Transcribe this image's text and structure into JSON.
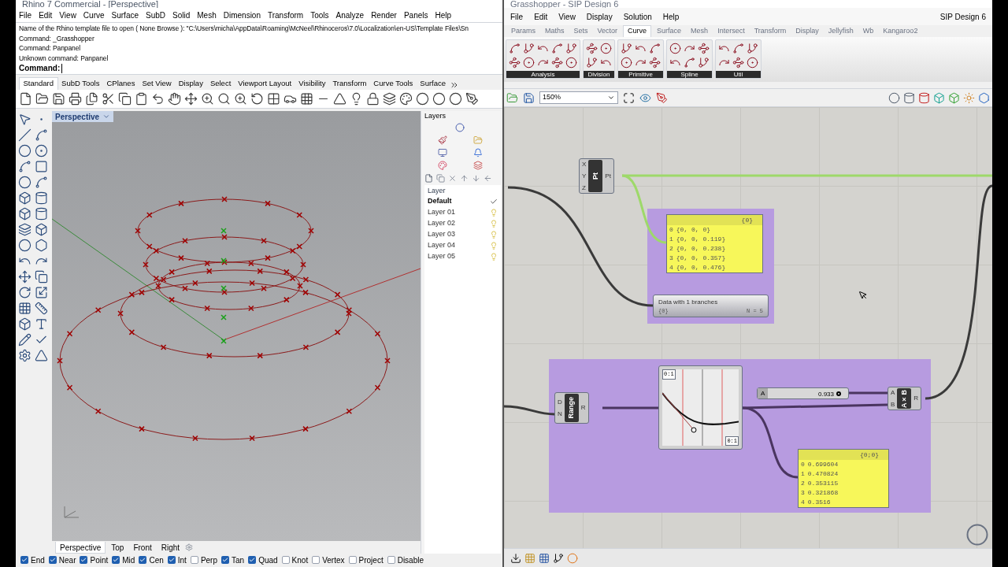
{
  "rhino": {
    "title": "Rhino 7 Commercial - [Perspective]",
    "menu": [
      "File",
      "Edit",
      "View",
      "Curve",
      "Surface",
      "SubD",
      "Solid",
      "Mesh",
      "Dimension",
      "Transform",
      "Tools",
      "Analyze",
      "Render",
      "Panels",
      "Help"
    ],
    "command_history": [
      "Name of the Rhino template file to open ( None  Browse ): \"C:\\Users\\micha\\AppData\\Roaming\\McNeel\\Rhinoceros\\7.0\\Localization\\en-US\\Template Files\\Sn",
      "Command: _Grasshopper",
      "Command: Panpanel",
      "Unknown command: Panpanel"
    ],
    "command_prompt": "Command:",
    "toolbar_tabs": [
      {
        "label": "Standard",
        "selected": true
      },
      {
        "label": "SubD Tools",
        "selected": false
      },
      {
        "label": "CPlanes",
        "selected": false
      },
      {
        "label": "Set View",
        "selected": false
      },
      {
        "label": "Display",
        "selected": false
      },
      {
        "label": "Select",
        "selected": false
      },
      {
        "label": "Viewport Layout",
        "selected": false
      },
      {
        "label": "Visibility",
        "selected": false
      },
      {
        "label": "Transform",
        "selected": false
      },
      {
        "label": "Curve Tools",
        "selected": false
      },
      {
        "label": "Surface",
        "selected": false
      }
    ],
    "viewport_title": "Perspective",
    "layers": {
      "title": "Layers",
      "column": "Layer",
      "items": [
        {
          "name": "Default",
          "current": true
        },
        {
          "name": "Layer 01",
          "current": false
        },
        {
          "name": "Layer 02",
          "current": false
        },
        {
          "name": "Layer 03",
          "current": false
        },
        {
          "name": "Layer 04",
          "current": false
        },
        {
          "name": "Layer 05",
          "current": false
        }
      ]
    },
    "viewport_tabs": [
      {
        "label": "Perspective",
        "selected": true
      },
      {
        "label": "Top",
        "selected": false
      },
      {
        "label": "Front",
        "selected": false
      },
      {
        "label": "Right",
        "selected": false
      }
    ],
    "osnaps": [
      {
        "label": "End",
        "checked": true
      },
      {
        "label": "Near",
        "checked": true
      },
      {
        "label": "Point",
        "checked": true
      },
      {
        "label": "Mid",
        "checked": true
      },
      {
        "label": "Cen",
        "checked": true
      },
      {
        "label": "Int",
        "checked": true
      },
      {
        "label": "Perp",
        "checked": false
      },
      {
        "label": "Tan",
        "checked": true
      },
      {
        "label": "Quad",
        "checked": true
      },
      {
        "label": "Knot",
        "checked": false
      },
      {
        "label": "Vertex",
        "checked": false
      },
      {
        "label": "Project",
        "checked": false
      },
      {
        "label": "Disable",
        "checked": false
      }
    ]
  },
  "grasshopper": {
    "title": "Grasshopper - SIP Design 6",
    "menu": [
      "File",
      "Edit",
      "View",
      "Display",
      "Solution",
      "Help"
    ],
    "document": "SIP Design 6",
    "tabs": [
      {
        "label": "Params",
        "selected": false
      },
      {
        "label": "Maths",
        "selected": false
      },
      {
        "label": "Sets",
        "selected": false
      },
      {
        "label": "Vector",
        "selected": false
      },
      {
        "label": "Curve",
        "selected": true
      },
      {
        "label": "Surface",
        "selected": false
      },
      {
        "label": "Mesh",
        "selected": false
      },
      {
        "label": "Intersect",
        "selected": false
      },
      {
        "label": "Transform",
        "selected": false
      },
      {
        "label": "Display",
        "selected": false
      },
      {
        "label": "Jellyfish",
        "selected": false
      },
      {
        "label": "Wb",
        "selected": false
      },
      {
        "label": "Kangaroo2",
        "selected": false
      }
    ],
    "ribbon_groups": [
      "Analysis",
      "Division",
      "Primitive",
      "Spline",
      "Util"
    ],
    "zoom": "150%",
    "point_component": {
      "inputs": [
        "X",
        "Y",
        "Z"
      ],
      "name": "Pt",
      "output": "Pt"
    },
    "points_panel": {
      "header": "{0}",
      "items": [
        {
          "index": "0",
          "value": "{0, 0, 0}"
        },
        {
          "index": "1",
          "value": "{0, 0, 0.119}"
        },
        {
          "index": "2",
          "value": "{0, 0, 0.238}"
        },
        {
          "index": "3",
          "value": "{0, 0, 0.357}"
        },
        {
          "index": "4",
          "value": "{0, 0, 0.476}"
        }
      ]
    },
    "param_viewer": {
      "title": "Data with 1 branches",
      "branch": "{0}",
      "count": "N = 5"
    },
    "range_component": {
      "inputs": [
        "D",
        "N"
      ],
      "name": "Range",
      "output": "R"
    },
    "graph_mapper": {
      "x_domain": "0:1",
      "y_domain": "0:1"
    },
    "slider": {
      "label": "A",
      "value": "0.933",
      "level": 0.93
    },
    "multiply_component": {
      "inputs": [
        "A",
        "B"
      ],
      "name": "A×B",
      "output": "R"
    },
    "values_panel": {
      "header": "{0;0}",
      "items": [
        {
          "index": "0",
          "value": "0.699604"
        },
        {
          "index": "1",
          "value": "0.470824"
        },
        {
          "index": "2",
          "value": "0.353115"
        },
        {
          "index": "3",
          "value": "0.321868"
        },
        {
          "index": "4",
          "value": "0.3516"
        }
      ]
    }
  }
}
